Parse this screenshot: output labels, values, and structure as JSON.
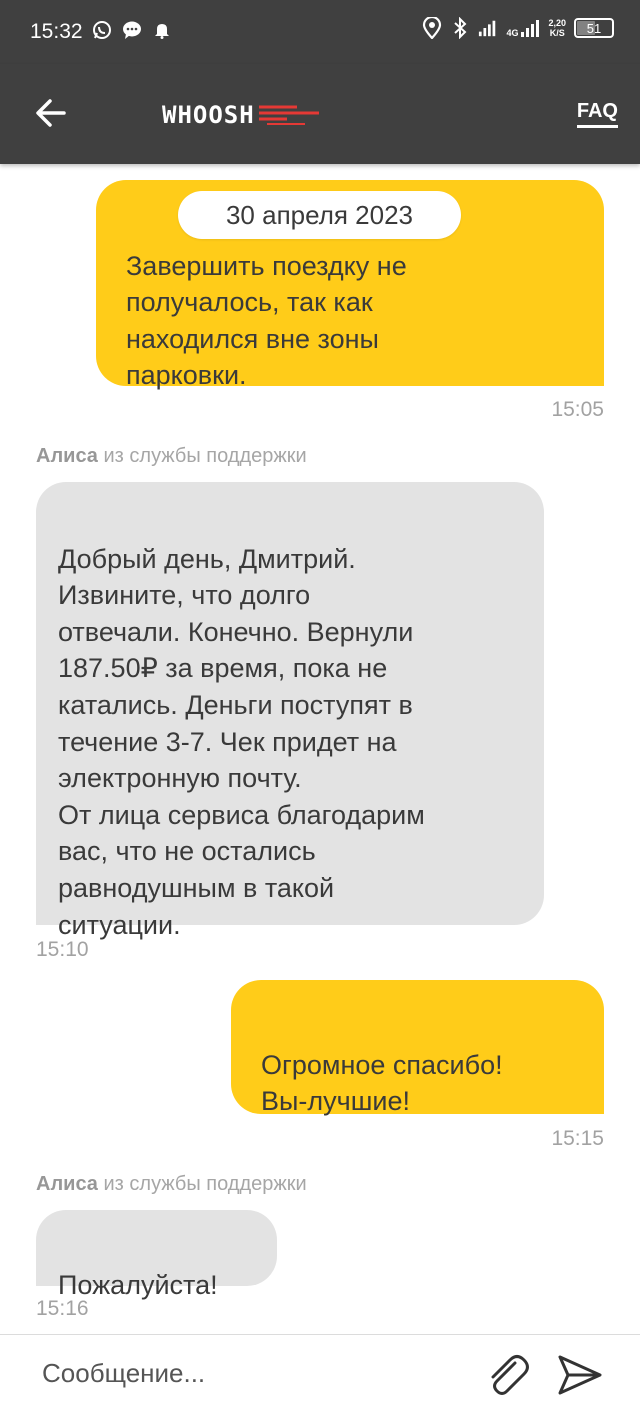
{
  "status_bar": {
    "time": "15:32",
    "network_label": "4G",
    "network_speed": "2,20",
    "network_speed_unit": "K/S",
    "battery_level": "51",
    "icons": [
      "whatsapp-icon",
      "chat-icon",
      "bell-icon",
      "location-icon",
      "bluetooth-icon",
      "signal-icon",
      "signal-4g-icon",
      "battery-icon"
    ]
  },
  "header": {
    "logo_text": "WHOOSH",
    "faq_label": "FAQ",
    "back_icon": "arrow-left-icon",
    "colors": {
      "bar": "#404040",
      "logo_accent": "#e53935"
    }
  },
  "chat": {
    "date_chip": "30 апреля 2023",
    "colors": {
      "outgoing": "#ffcc19",
      "incoming": "#e3e3e3"
    },
    "messages": [
      {
        "direction": "out",
        "text": "Завершить поездку не\nполучалось, так как\nнаходился вне зоны\nпарковки.",
        "time": "15:05"
      },
      {
        "direction": "in",
        "sender_name": "Алиса",
        "sender_suffix": " из службы поддержки",
        "text": "Добрый день, Дмитрий.\nИзвините, что долго\nотвечали. Конечно. Вернули\n187.50₽ за время, пока не\nкатались. Деньги поступят в\nтечение 3-7. Чек придет на\nэлектронную почту.\nОт лица сервиса благодарим\nвас, что не остались\nравнодушным в такой\nситуации.",
        "time": "15:10"
      },
      {
        "direction": "out",
        "text": "Огромное спасибо!\nВы-лучшие!",
        "time": "15:15"
      },
      {
        "direction": "in",
        "sender_name": "Алиса",
        "sender_suffix": " из службы поддержки",
        "text": "Пожалуйста!",
        "time": "15:16"
      }
    ]
  },
  "composer": {
    "placeholder": "Сообщение...",
    "attach_icon": "paperclip-icon",
    "send_icon": "send-icon"
  }
}
